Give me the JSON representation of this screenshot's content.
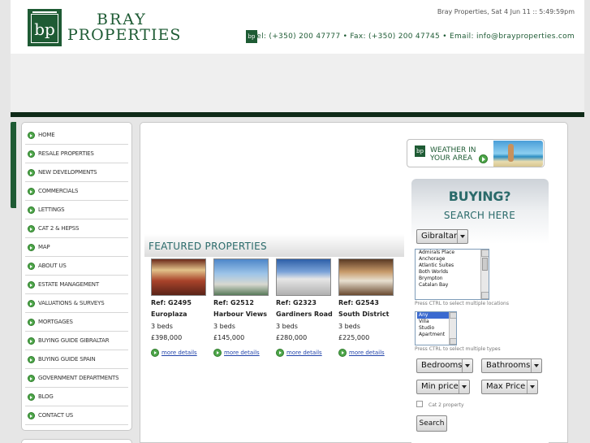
{
  "header": {
    "logo_text": "bp",
    "brand_line1": "BRAY",
    "brand_line2": "PROPERTIES",
    "datetime": "Bray Properties, Sat 4 Jun 11 :: 5:49:59pm",
    "contact_icon": "bp",
    "contact": "Tel: (+350) 200 47777 • Fax: (+350) 200 47745 • Email: info@brayproperties.com"
  },
  "sidebar": {
    "items": [
      {
        "label": "HOME",
        "icon": "arrow-bullet-icon"
      },
      {
        "label": "RESALE PROPERTIES",
        "icon": "arrow-bullet-icon"
      },
      {
        "label": "NEW DEVELOPMENTS",
        "icon": "arrow-bullet-icon"
      },
      {
        "label": "COMMERCIALS",
        "icon": "arrow-bullet-icon"
      },
      {
        "label": "LETTINGS",
        "icon": "arrow-bullet-icon"
      },
      {
        "label": "CAT 2 & HEPSS",
        "icon": "arrow-bullet-icon"
      },
      {
        "label": "MAP",
        "icon": "arrow-bullet-icon"
      },
      {
        "label": "ABOUT US",
        "icon": "arrow-bullet-icon"
      },
      {
        "label": "ESTATE MANAGEMENT",
        "icon": "arrow-bullet-icon"
      },
      {
        "label": "VALUATIONS & SURVEYS",
        "icon": "arrow-bullet-icon"
      },
      {
        "label": "MORTGAGES",
        "icon": "arrow-bullet-icon"
      },
      {
        "label": "BUYING GUIDE GIBRALTAR",
        "icon": "arrow-bullet-icon"
      },
      {
        "label": "BUYING GUIDE SPAIN",
        "icon": "arrow-bullet-icon"
      },
      {
        "label": "GOVERNMENT DEPARTMENTS",
        "icon": "arrow-bullet-icon"
      },
      {
        "label": "BLOG",
        "icon": "arrow-bullet-icon"
      },
      {
        "label": "CONTACT US",
        "icon": "arrow-bullet-icon"
      }
    ]
  },
  "featured": {
    "heading": "FEATURED PROPERTIES",
    "properties": [
      {
        "ref": "Ref: G2495",
        "name": "Europlaza",
        "beds": "3 beds",
        "price": "£398,000",
        "more": "more details"
      },
      {
        "ref": "Ref: G2512",
        "name": "Harbour Views",
        "beds": "3 beds",
        "price": "£145,000",
        "more": "more details"
      },
      {
        "ref": "Ref: G2323",
        "name": "Gardiners Road",
        "beds": "3 beds",
        "price": "£280,000",
        "more": "more details"
      },
      {
        "ref": "Ref: G2543",
        "name": "South District",
        "beds": "3 beds",
        "price": "£225,000",
        "more": "more details"
      }
    ]
  },
  "weather": {
    "logo": "bp",
    "line1": "WEATHER IN",
    "line2": "YOUR AREA"
  },
  "search": {
    "heading": "BUYING?",
    "subheading": "SEARCH HERE",
    "country": "Gibraltar",
    "locations": [
      "Admirals Place",
      "Anchorage",
      "Atlantic Suites",
      "Both Worlds",
      "Brympton",
      "Catalan Bay"
    ],
    "locations_hint": "Press CTRL to select multiple locations",
    "types": [
      "Any",
      "Villa",
      "Studio",
      "Apartment"
    ],
    "types_selected": "Any",
    "types_hint": "Press CTRL to select multiple types",
    "bedrooms": "Bedrooms",
    "bathrooms": "Bathrooms",
    "min_price": "Min price",
    "max_price": "Max Price",
    "cat2_label": "Cat 2 property",
    "search_button": "Search"
  },
  "colors": {
    "brand_green": "#1e5b34",
    "teal_heading": "#2a6a6a",
    "bullet_green": "#4ea64a"
  }
}
